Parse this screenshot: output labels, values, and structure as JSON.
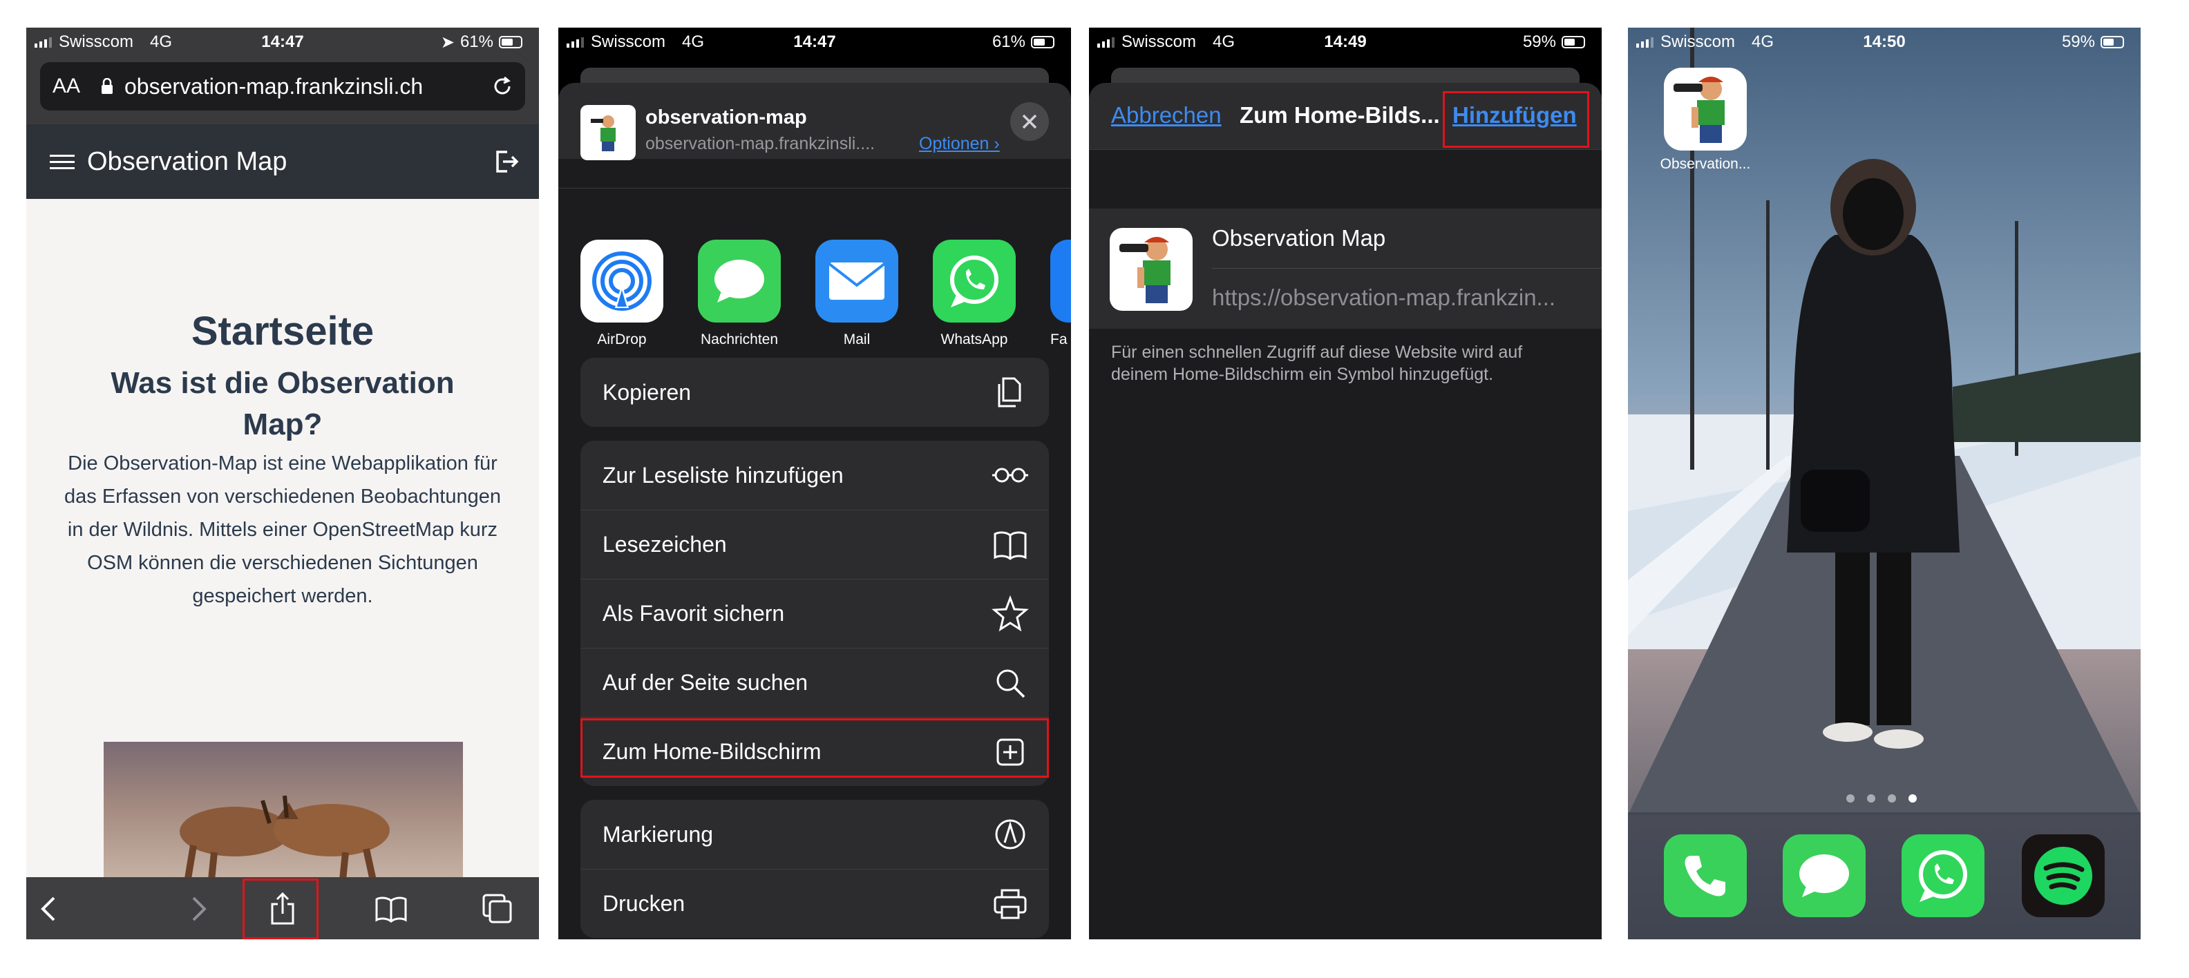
{
  "phone1": {
    "status": {
      "carrier": "Swisscom",
      "network": "4G",
      "time": "14:47",
      "battery": "61%"
    },
    "url_bar": {
      "text_size": "AA",
      "url": "observation-map.frankzinsli.ch"
    },
    "app_title": "Observation Map",
    "heading": "Startseite",
    "subheading": "Was ist die Observation Map?",
    "paragraph": "Die Observation-Map ist eine Webapplikation für das Erfassen von verschiedenen Beobachtungen in der Wildnis. Mittels einer OpenStreetMap kurz OSM können die verschiedenen Sichtungen gespeichert werden."
  },
  "phone2": {
    "status": {
      "carrier": "Swisscom",
      "network": "4G",
      "time": "14:47",
      "battery": "61%"
    },
    "share_title": "observation-map",
    "share_subtitle": "observation-map.frankzinsli....",
    "options_label": "Optionen",
    "apps": [
      {
        "label": "AirDrop",
        "color": "#ffffff"
      },
      {
        "label": "Nachrichten",
        "color": "#3ad15b"
      },
      {
        "label": "Mail",
        "color": "#2a8cf3"
      },
      {
        "label": "WhatsApp",
        "color": "#2fd65a"
      },
      {
        "label": "Fa",
        "color": "#1d7cf2"
      }
    ],
    "copy": "Kopieren",
    "actions": [
      "Zur Leseliste hinzufügen",
      "Lesezeichen",
      "Als Favorit sichern",
      "Auf der Seite suchen",
      "Zum Home-Bildschirm"
    ],
    "actions2": [
      "Markierung",
      "Drucken"
    ]
  },
  "phone3": {
    "status": {
      "carrier": "Swisscom",
      "network": "4G",
      "time": "14:49",
      "battery": "59%"
    },
    "cancel": "Abbrechen",
    "title": "Zum Home-Bilds...",
    "add": "Hinzufügen",
    "app_name": "Observation Map",
    "app_url": "https://observation-map.frankzin...",
    "note": "Für einen schnellen Zugriff auf diese Website wird auf deinem Home-Bildschirm ein Symbol hinzugefügt."
  },
  "phone4": {
    "status": {
      "carrier": "Swisscom",
      "network": "4G",
      "time": "14:50",
      "battery": "59%"
    },
    "home_icon_label": "Observation..."
  }
}
